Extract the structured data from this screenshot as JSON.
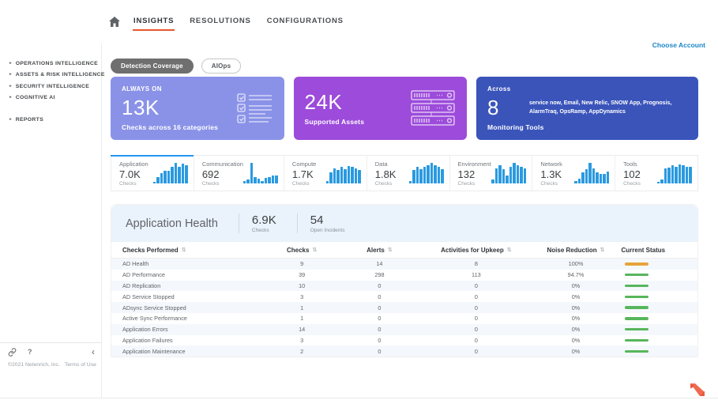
{
  "nav": {
    "items": [
      {
        "label": "INSIGHTS",
        "active": true
      },
      {
        "label": "RESOLUTIONS",
        "active": false
      },
      {
        "label": "CONFIGURATIONS",
        "active": false
      }
    ],
    "choose_account": "Choose Account"
  },
  "icons": {
    "expand_arrow": "▸",
    "sort": "⇅",
    "help": "?",
    "collapse": "‹"
  },
  "sidebar": {
    "groups": [
      {
        "items": [
          "OPERATIONS INTELLIGENCE",
          "ASSETS & RISK INTELLIGENCE",
          "SECURITY INTELLIGENCE",
          "COGNITIVE AI"
        ]
      },
      {
        "items": [
          "REPORTS"
        ]
      }
    ],
    "footer": {
      "copyright": "©2021 Netenrich, Inc.",
      "terms": "Terms of Use"
    }
  },
  "filters": [
    {
      "label": "Detection Coverage",
      "active": true
    },
    {
      "label": "AIOps",
      "active": false
    }
  ],
  "summary_cards": [
    {
      "eyebrow": "ALWAYS ON",
      "value": "13K",
      "caption": "Checks across 16 categories",
      "icon": "checklist-icon",
      "color": "#8a92e8"
    },
    {
      "value": "24K",
      "caption": "Supported Assets",
      "icon": "servers-icon",
      "color": "#9c4bdb"
    },
    {
      "eyebrow": "Across",
      "value": "8",
      "caption": "Monitoring Tools",
      "detail": "service now, Email, New Relic, SNOW App, Prognosis, AlarmTraq, OpsRamp, AppDynamics",
      "color": "#3a54ba"
    }
  ],
  "chart_data": {
    "type": "bar",
    "title": "Checks by category (sparkline tabs)",
    "bar_color": "#2b9ae0",
    "series": [
      {
        "name": "Application",
        "total": "7.0K",
        "sublabel": "Checks",
        "active": true,
        "values": [
          8,
          30,
          50,
          60,
          60,
          82,
          100,
          82,
          98,
          88
        ]
      },
      {
        "name": "Communication",
        "total": "692",
        "sublabel": "Checks",
        "active": false,
        "values": [
          10,
          20,
          100,
          32,
          22,
          10,
          28,
          30,
          40,
          40
        ]
      },
      {
        "name": "Compute",
        "total": "1.7K",
        "sublabel": "Checks",
        "active": false,
        "values": [
          10,
          55,
          75,
          65,
          80,
          70,
          85,
          80,
          75,
          65
        ]
      },
      {
        "name": "Data",
        "total": "1.8K",
        "sublabel": "Checks",
        "active": false,
        "values": [
          12,
          65,
          80,
          70,
          82,
          90,
          100,
          90,
          80,
          70
        ]
      },
      {
        "name": "Environment",
        "total": "132",
        "sublabel": "Checks",
        "active": false,
        "values": [
          18,
          75,
          90,
          70,
          38,
          80,
          100,
          90,
          82,
          72
        ]
      },
      {
        "name": "Network",
        "total": "1.3K",
        "sublabel": "Checks",
        "active": false,
        "values": [
          10,
          22,
          55,
          70,
          100,
          72,
          55,
          45,
          45,
          58
        ]
      },
      {
        "name": "Tools",
        "total": "102",
        "sublabel": "Checks",
        "active": false,
        "values": [
          8,
          20,
          75,
          78,
          88,
          80,
          92,
          90,
          82,
          82
        ]
      }
    ]
  },
  "section": {
    "title": "Application Health",
    "stats": [
      {
        "value": "6.9K",
        "label": "Checks"
      },
      {
        "value": "54",
        "label": "Open Incidents"
      }
    ]
  },
  "table": {
    "columns": [
      {
        "label": "Checks Performed",
        "sortable": true,
        "align": "left"
      },
      {
        "label": "Checks",
        "sortable": true,
        "align": "center"
      },
      {
        "label": "Alerts",
        "sortable": true,
        "align": "center"
      },
      {
        "label": "Activities for Upkeep",
        "sortable": true,
        "align": "center"
      },
      {
        "label": "Noise Reduction",
        "sortable": true,
        "align": "center"
      },
      {
        "label": "Current Status",
        "sortable": false,
        "align": "left"
      }
    ],
    "rows": [
      {
        "name": "AD Health",
        "checks": "9",
        "alerts": "14",
        "upkeep": "8",
        "noise": "100%",
        "status_color": "#e8a33c"
      },
      {
        "name": "AD Performance",
        "checks": "39",
        "alerts": "298",
        "upkeep": "113",
        "noise": "94.7%",
        "status_color": "#57b65b"
      },
      {
        "name": "AD Replication",
        "checks": "10",
        "alerts": "0",
        "upkeep": "0",
        "noise": "0%",
        "status_color": "#57b65b"
      },
      {
        "name": "AD Service Stopped",
        "checks": "3",
        "alerts": "0",
        "upkeep": "0",
        "noise": "0%",
        "status_color": "#57b65b"
      },
      {
        "name": "ADsync Service Stopped",
        "checks": "1",
        "alerts": "0",
        "upkeep": "0",
        "noise": "0%",
        "status_color": "#57b65b"
      },
      {
        "name": "Active Sync Performance",
        "checks": "1",
        "alerts": "0",
        "upkeep": "0",
        "noise": "0%",
        "status_color": "#57b65b"
      },
      {
        "name": "Application Errors",
        "checks": "14",
        "alerts": "0",
        "upkeep": "0",
        "noise": "0%",
        "status_color": "#57b65b"
      },
      {
        "name": "Application Failures",
        "checks": "3",
        "alerts": "0",
        "upkeep": "0",
        "noise": "0%",
        "status_color": "#57b65b"
      },
      {
        "name": "Application Maintenance",
        "checks": "2",
        "alerts": "0",
        "upkeep": "0",
        "noise": "0%",
        "status_color": "#57b65b"
      }
    ]
  },
  "colors": {
    "accent_orange": "#e8572e",
    "spark_blue": "#2b9ae0",
    "header_band": "#eaf2fb",
    "alt_row": "#f4f8fc",
    "link_blue": "#1b87c9"
  }
}
